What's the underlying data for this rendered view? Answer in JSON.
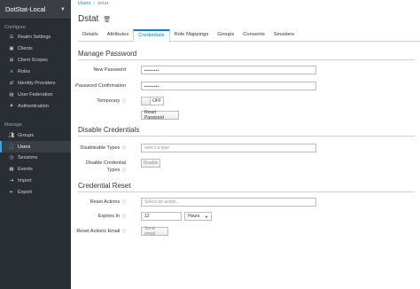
{
  "sidebar": {
    "realm": "DotStat-Local",
    "configure_title": "Configure",
    "configure_items": [
      {
        "label": "Realm Settings",
        "icon": "sliders-icon"
      },
      {
        "label": "Clients",
        "icon": "cube-icon"
      },
      {
        "label": "Client Scopes",
        "icon": "scopes-icon"
      },
      {
        "label": "Roles",
        "icon": "roles-icon"
      },
      {
        "label": "Identity Providers",
        "icon": "exchange-icon"
      },
      {
        "label": "User Federation",
        "icon": "database-icon"
      },
      {
        "label": "Authentication",
        "icon": "lock-icon"
      }
    ],
    "manage_title": "Manage",
    "manage_items": [
      {
        "label": "Groups",
        "icon": "users-icon"
      },
      {
        "label": "Users",
        "icon": "user-icon"
      },
      {
        "label": "Sessions",
        "icon": "clock-icon"
      },
      {
        "label": "Events",
        "icon": "calendar-icon"
      },
      {
        "label": "Import",
        "icon": "import-icon"
      },
      {
        "label": "Export",
        "icon": "export-icon"
      }
    ],
    "active_item": "Users",
    "accent_color": "#39a5dc"
  },
  "breadcrumb": {
    "parent": "Users",
    "current": "dstat"
  },
  "title": "Dstat",
  "tabs": [
    "Details",
    "Attributes",
    "Credentials",
    "Role Mappings",
    "Groups",
    "Consents",
    "Sessions"
  ],
  "active_tab": "Credentials",
  "manage_password": {
    "heading": "Manage Password",
    "new_password_label": "New Password",
    "new_password_value": "••••••••",
    "confirm_label": "Password Confirmation",
    "confirm_value": "••••••••",
    "temporary_label": "Temporary",
    "temporary_state": "OFF",
    "reset_button": "Reset Password"
  },
  "disable_credentials": {
    "heading": "Disable Credentials",
    "disableable_label": "Disableable Types",
    "disableable_placeholder": "select a type",
    "disable_label_1": "Disable Credential",
    "disable_label_2": "Types",
    "disable_button": "Disable"
  },
  "credential_reset": {
    "heading": "Credential Reset",
    "reset_actions_label": "Reset Actions",
    "reset_actions_placeholder": "Select an action...",
    "expires_label": "Expires In",
    "expires_value": "12",
    "expires_unit": "Hours",
    "email_label": "Reset Actions Email",
    "email_button": "Send email"
  }
}
